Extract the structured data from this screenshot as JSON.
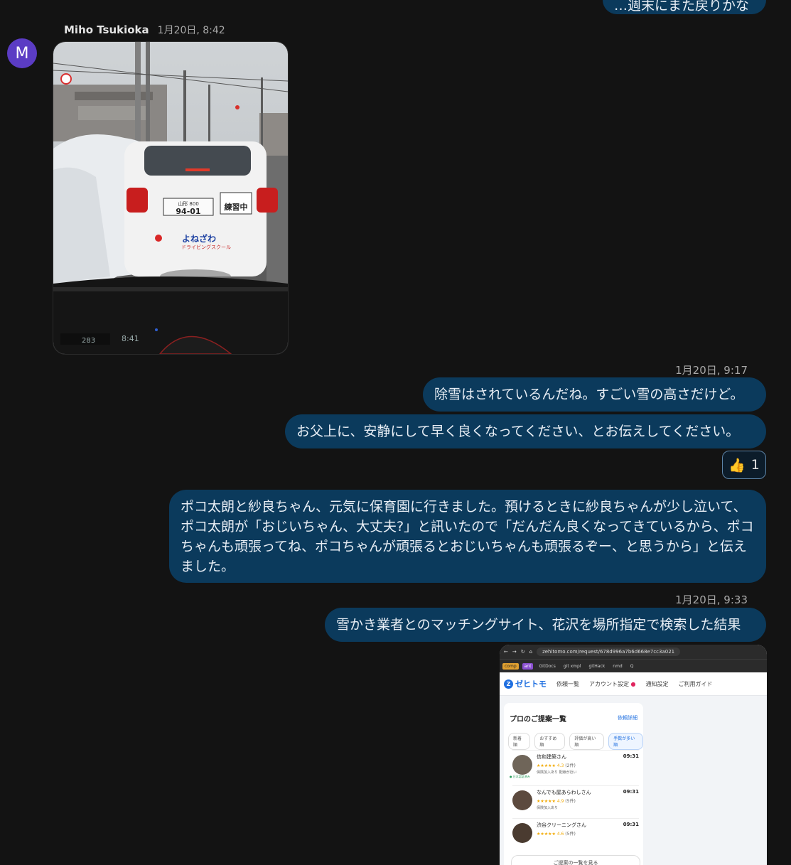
{
  "top_bubble": {
    "text": "…週末にまた戻りかな"
  },
  "incoming": {
    "avatar_letter": "M",
    "sender": "Miho Tsukioka",
    "time": "1月20日, 8:42"
  },
  "photo": {
    "plate_region": "山形 800",
    "plate_number": "94-01",
    "practice_label": "練習中",
    "school_name": "よねざわ",
    "school_sub": "ドライビングスクール",
    "dash_odometer": "283",
    "dash_clock": "8:41"
  },
  "group1": {
    "timestamp": "1月20日, 9:17",
    "msg1": "除雪はされているんだね。すごい雪の高さだけど。",
    "msg2": "お父上に、安静にして早く良くなってください、とお伝えしてください。",
    "reaction_emoji": "👍",
    "reaction_count": "1",
    "msg3": "ポコ太朗と紗良ちゃん、元気に保育園に行きました。預けるときに紗良ちゃんが少し泣いて、ポコ太朗が「おじいちゃん、大丈夫?」と訊いたので「だんだん良くなってきているから、ポコちゃんも頑張ってね、ポコちゃんが頑張るとおじいちゃんも頑張るぞー、と思うから」と伝えました。"
  },
  "group2": {
    "timestamp": "1月20日, 9:33",
    "msg1": "雪かき業者とのマッチングサイト、花沢を場所指定で検索した結果"
  },
  "screenshot": {
    "url": "zehitomo.com/request/678d996a7b6d668e7cc3a021",
    "bookmarks": [
      "comp",
      "ant",
      "",
      "",
      "",
      "",
      "",
      "GitDocs",
      "",
      "git xmpl",
      "gitHack",
      "nmd",
      "Q"
    ],
    "logo": "ゼヒトモ",
    "nav": [
      "依頼一覧",
      "アカウント設定",
      "通知設定",
      "ご利用ガイド"
    ],
    "panel_title": "プロのご提案一覧",
    "panel_link": "依頼詳細",
    "chips": [
      "新着順",
      "おすすめ順",
      "評価が高い順",
      "手数が多い順"
    ],
    "pros": [
      {
        "name": "信和建築さん",
        "time": "09:31",
        "stars": "★★★★★",
        "rating": "4.3",
        "count": "(2件)",
        "note": "保険加入あり 配線が近い",
        "badge": "● 日本認証済み"
      },
      {
        "name": "なんでも屋あらわしさん",
        "time": "09:31",
        "stars": "★★★★★",
        "rating": "4.9",
        "count": "(5件)",
        "note": "保険加入あり",
        "badge": ""
      },
      {
        "name": "渋谷クリーニングさん",
        "time": "09:31",
        "stars": "★★★★★",
        "rating": "4.6",
        "count": "(5件)",
        "note": "",
        "badge": ""
      }
    ],
    "more_button": "ご提案の一覧を見る"
  },
  "colors": {
    "background": "#131313",
    "outgoing_bubble": "#0b3a5c",
    "avatar": "#5b3cc4"
  }
}
